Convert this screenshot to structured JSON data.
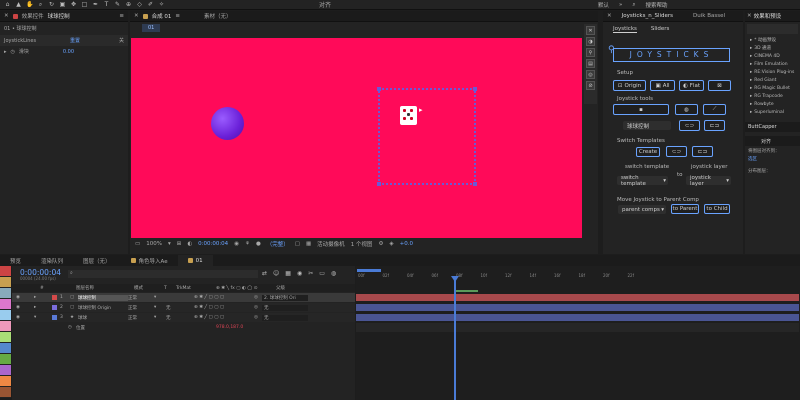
{
  "toolbar": {
    "workspace_default": "默认",
    "search_help": "搜索帮助",
    "align_label": "对齐"
  },
  "left_panel": {
    "tab_label": "效果控件",
    "tab_layer": "球球控制",
    "breadcrumb": "01 • 球球控制",
    "property_name": "JoystickLines",
    "reset_label": "重置",
    "about_label": "关",
    "sub_property": "滑块",
    "sub_value": "0.00"
  },
  "comp_panel": {
    "tab_comp": "合成 01",
    "tab_footage": "素材（无）",
    "comp_label": "01",
    "zoom": "100%",
    "timecode": "0:00:00:04",
    "quality": "（完整）",
    "camera": "活动摄像机",
    "views": "1 个视图",
    "exposure": "+0.0"
  },
  "joystick_panel": {
    "title": "Joysticks_n_Sliders",
    "extra_tab": "Duik Bassel",
    "tab_joysticks": "Joysticks",
    "tab_sliders": "Sliders",
    "logo_text": "JOYSTICKS",
    "setup_label": "Setup",
    "btn_origin": "Origin",
    "btn_all": "All",
    "btn_flat": "Flat",
    "joystick_tools_label": "Joystick tools",
    "dropdown_control": "球球控制",
    "switch_templates_label": "Switch Templates",
    "btn_create": "Create",
    "switch_template_label": "switch template",
    "joystick_layer_label": "joystick layer",
    "to_label": "to",
    "dropdown_switch_template": "switch template",
    "dropdown_joystick_layer": "joystick layer",
    "move_joystick_label": "Move Joystick to Parent Comp",
    "dropdown_parent_comps": "parent comps",
    "btn_to_parent": "to Parent",
    "btn_to_child": "to Child"
  },
  "presets_panel": {
    "title": "效果和预设",
    "items": [
      "* 动画预设",
      "3D 通道",
      "CINEMA 4D",
      "Film Emulation",
      "RE:Vision Plug-ins",
      "Red Giant",
      "RG Magic Bullet",
      "RG Trapcode",
      "Rowbyte",
      "Superluminal"
    ],
    "section_buttcapper": "ButtCapper",
    "section_align": "对齐",
    "align_layers_to": "将图层对齐到：",
    "align_selection": "选区",
    "distribute_layers": "分布图层："
  },
  "timeline": {
    "tabs": [
      "预览",
      "渲染队列",
      "图层（无）",
      "角色导入Ae",
      "01"
    ],
    "timecode": "0:00:00:04",
    "sub_timecode": "00004 (24.00 fps)",
    "search_placeholder": "",
    "col_layer_name": "图层名称",
    "col_mode": "模式",
    "col_t": "T",
    "col_trkmat": "TrkMat",
    "col_parent": "父级",
    "layers": [
      {
        "num": "1",
        "name": "球球控制",
        "mode": "正常",
        "parent": "2. 球球控制 Ori",
        "color": "#d44a4a",
        "selected": true
      },
      {
        "num": "2",
        "name": "球球控制 Origin",
        "mode": "正常",
        "trkmat": "无",
        "parent": "无",
        "color": "#7b6ddd",
        "selected": false
      },
      {
        "num": "3",
        "name": "球球",
        "mode": "正常",
        "trkmat": "无",
        "parent": "无",
        "color": "#5a7ad6",
        "selected": false
      }
    ],
    "property_position": "位置",
    "property_value": "978.0,187.0",
    "ruler_ticks": [
      "00f",
      "02f",
      "04f",
      "06f",
      "08f",
      "10f",
      "12f",
      "14f",
      "16f",
      "18f",
      "20f",
      "22f"
    ]
  },
  "colors": {
    "viewer_bg": "#ff0a59",
    "accent": "#6aa3ff",
    "timeline_red": "#a8494c",
    "timeline_blue": "#4a5593"
  }
}
